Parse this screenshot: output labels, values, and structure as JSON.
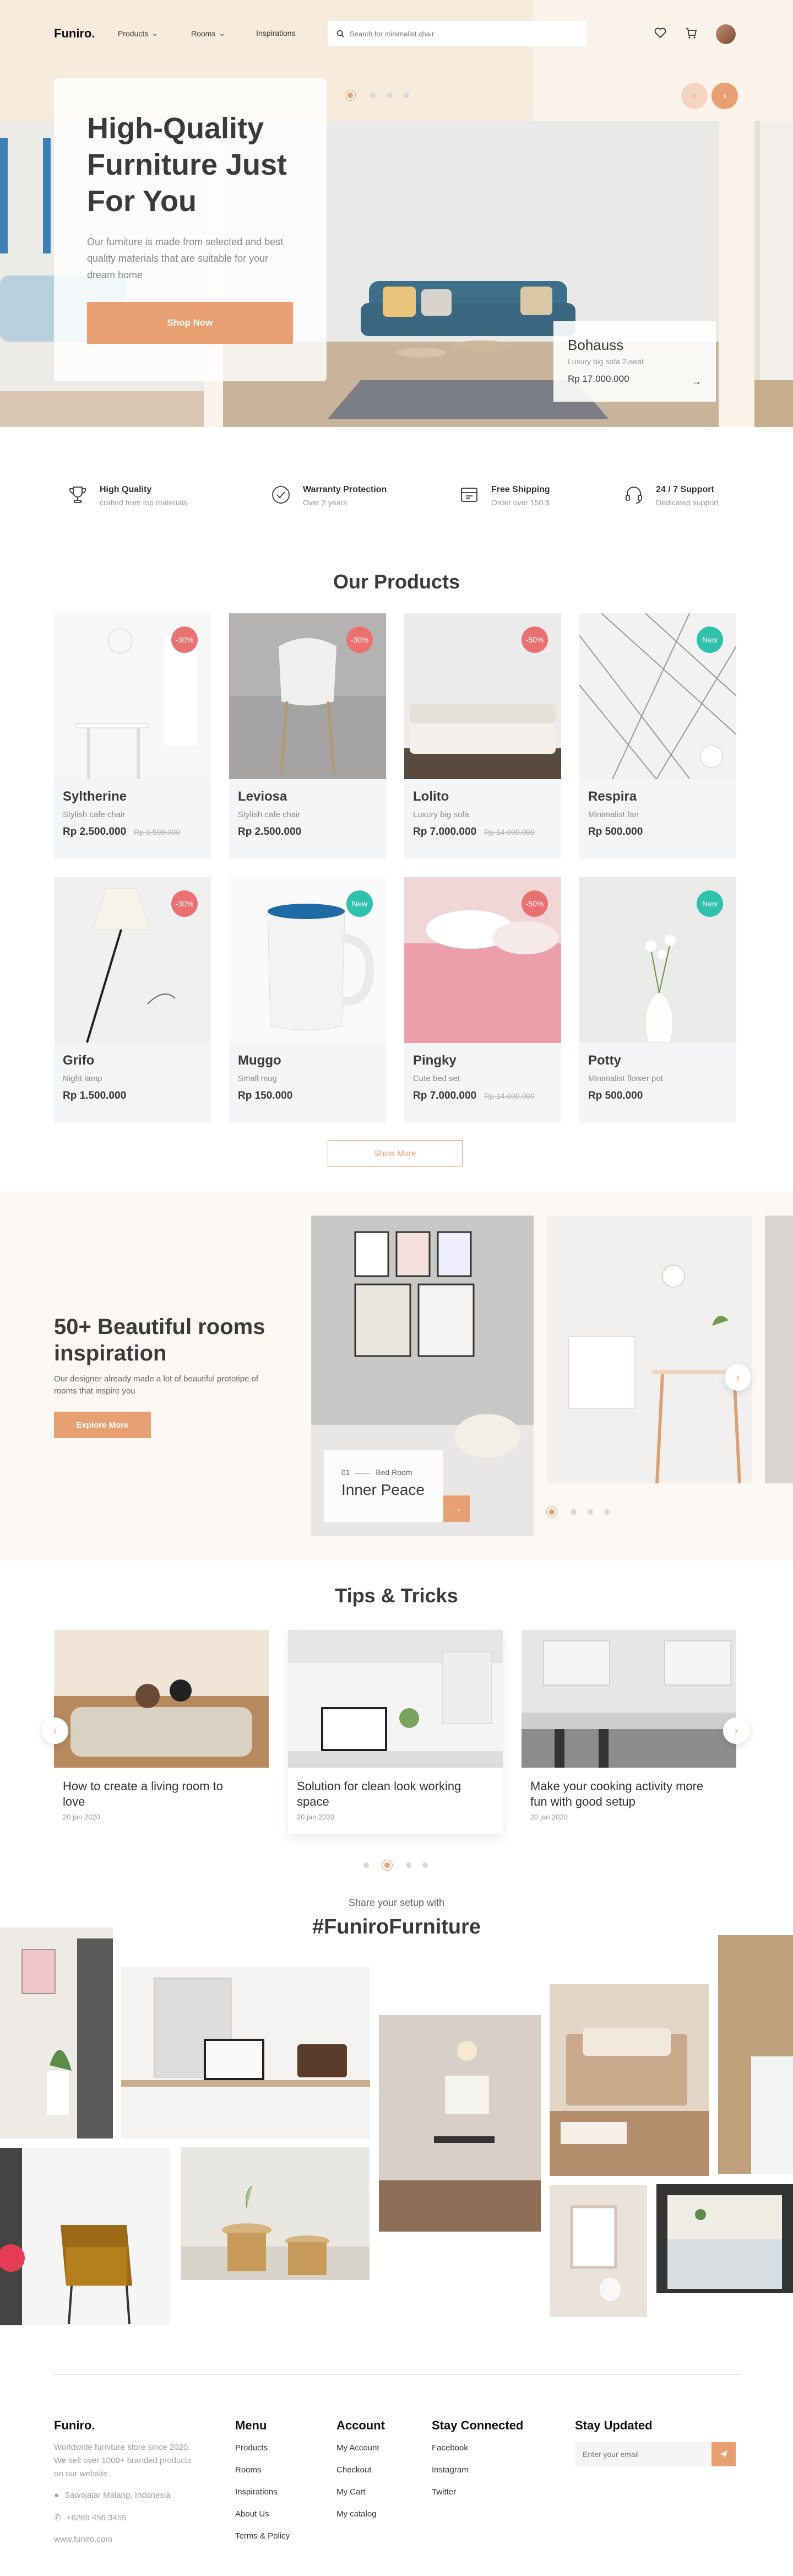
{
  "header": {
    "logo": "Funiro.",
    "nav": [
      "Products",
      "Rooms",
      "Inspirations"
    ],
    "search_placeholder": "Search for minimalist chair"
  },
  "hero": {
    "title": "High-Quality Furniture Just For You",
    "description": "Our furniture is made from selected and best quality materials that are suitable for your dream home",
    "cta": "Shop Now",
    "featured": {
      "name": "Bohauss",
      "subtitle": "Luxury big sofa 2-seat",
      "price": "Rp 17.000.000"
    }
  },
  "features": [
    {
      "title": "High Quality",
      "subtitle": "crafted from top materials",
      "icon": "trophy-icon"
    },
    {
      "title": "Warranty Protection",
      "subtitle": "Over 2 years",
      "icon": "check-circle-icon"
    },
    {
      "title": "Free Shipping",
      "subtitle": "Order over 150 $",
      "icon": "shipping-icon"
    },
    {
      "title": "24 / 7 Support",
      "subtitle": "Dedicated support",
      "icon": "headset-icon"
    }
  ],
  "products": {
    "title": "Our Products",
    "items": [
      {
        "name": "Syltherine",
        "sub": "Stylish cafe chair",
        "price": "Rp 2.500.000",
        "old": "Rp 3.500.000",
        "badge": "-30%",
        "badge_color": "#e97171"
      },
      {
        "name": "Leviosa",
        "sub": "Stylish cafe chair",
        "price": "Rp 2.500.000",
        "old": "",
        "badge": "-30%",
        "badge_color": "#e97171"
      },
      {
        "name": "Lolito",
        "sub": "Luxury big sofa",
        "price": "Rp 7.000.000",
        "old": "Rp 14.000.000",
        "badge": "-50%",
        "badge_color": "#e97171"
      },
      {
        "name": "Respira",
        "sub": "Minimalist fan",
        "price": "Rp 500.000",
        "old": "",
        "badge": "New",
        "badge_color": "#2ec1ac"
      },
      {
        "name": "Grifo",
        "sub": "Night lamp",
        "price": "Rp 1.500.000",
        "old": "",
        "badge": "-30%",
        "badge_color": "#e97171"
      },
      {
        "name": "Muggo",
        "sub": "Small mug",
        "price": "Rp 150.000",
        "old": "",
        "badge": "New",
        "badge_color": "#2ec1ac"
      },
      {
        "name": "Pingky",
        "sub": "Cute bed set",
        "price": "Rp 7.000.000",
        "old": "Rp 14.000.000",
        "badge": "-50%",
        "badge_color": "#e97171"
      },
      {
        "name": "Potty",
        "sub": "Minimalist flower pot",
        "price": "Rp 500.000",
        "old": "",
        "badge": "New",
        "badge_color": "#2ec1ac"
      }
    ],
    "show_more": "Show More"
  },
  "rooms": {
    "title": "50+ Beautiful rooms inspiration",
    "description": "Our designer already made a lot of beautiful prototipe of rooms that inspire you",
    "cta": "Explore More",
    "active": {
      "index": "01",
      "category": "Bed Room",
      "name": "Inner Peace"
    }
  },
  "tips": {
    "title": "Tips & Tricks",
    "items": [
      {
        "title": "How to create a living room to love",
        "date": "20 jan 2020"
      },
      {
        "title": "Solution for clean look working space",
        "date": "20 jan 2020"
      },
      {
        "title": "Make your cooking activity more fun with good setup",
        "date": "20 jan 2020"
      }
    ]
  },
  "gallery": {
    "subtitle": "Share your setup with",
    "title": "#FuniroFurniture"
  },
  "footer": {
    "brand": "Funiro.",
    "description": "Worldwide furniture store since 2020. We sell over 1000+ branded products on our website",
    "address": "Sawojajar Malang, Indonesia",
    "phone": "+6289 456 3455",
    "website": "www.funiro.com",
    "menu_title": "Menu",
    "menu": [
      "Products",
      "Rooms",
      "Inspirations",
      "About Us",
      "Terms & Policy"
    ],
    "account_title": "Account",
    "account": [
      "My Account",
      "Checkout",
      "My Cart",
      "My catalog"
    ],
    "social_title": "Stay Connected",
    "social": [
      "Facebook",
      "Instagram",
      "Twitter"
    ],
    "news_title": "Stay Updated",
    "email_placeholder": "Enter your email"
  },
  "colors": {
    "accent": "#e89f71",
    "sale": "#e97171",
    "new": "#2ec1ac"
  }
}
